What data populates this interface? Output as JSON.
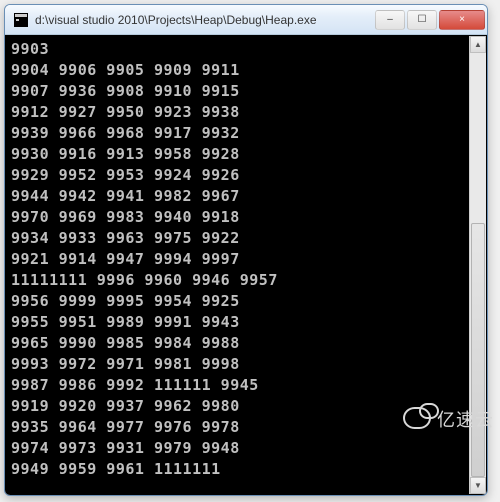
{
  "window": {
    "title": "d:\\visual studio 2010\\Projects\\Heap\\Debug\\Heap.exe",
    "icon_name": "console-icon",
    "buttons": {
      "minimize": "–",
      "maximize": "☐",
      "close": "×"
    }
  },
  "console": {
    "lines": [
      "9903",
      "9904 9906 9905 9909 9911",
      "9907 9936 9908 9910 9915",
      "9912 9927 9950 9923 9938",
      "9939 9966 9968 9917 9932",
      "9930 9916 9913 9958 9928",
      "9929 9952 9953 9924 9926",
      "9944 9942 9941 9982 9967",
      "9970 9969 9983 9940 9918",
      "9934 9933 9963 9975 9922",
      "9921 9914 9947 9994 9997",
      "11111111 9996 9960 9946 9957",
      "9956 9999 9995 9954 9925",
      "9955 9951 9989 9991 9943",
      "9965 9990 9985 9984 9988",
      "9993 9972 9971 9981 9998",
      "9987 9986 9992 111111 9945",
      "9919 9920 9937 9962 9980",
      "9935 9964 9977 9976 9978",
      "9974 9973 9931 9979 9948",
      "9949 9959 9961 1111111"
    ]
  },
  "watermark": {
    "text": "亿速云"
  },
  "scrollbar": {
    "up": "▲",
    "down": "▼"
  }
}
